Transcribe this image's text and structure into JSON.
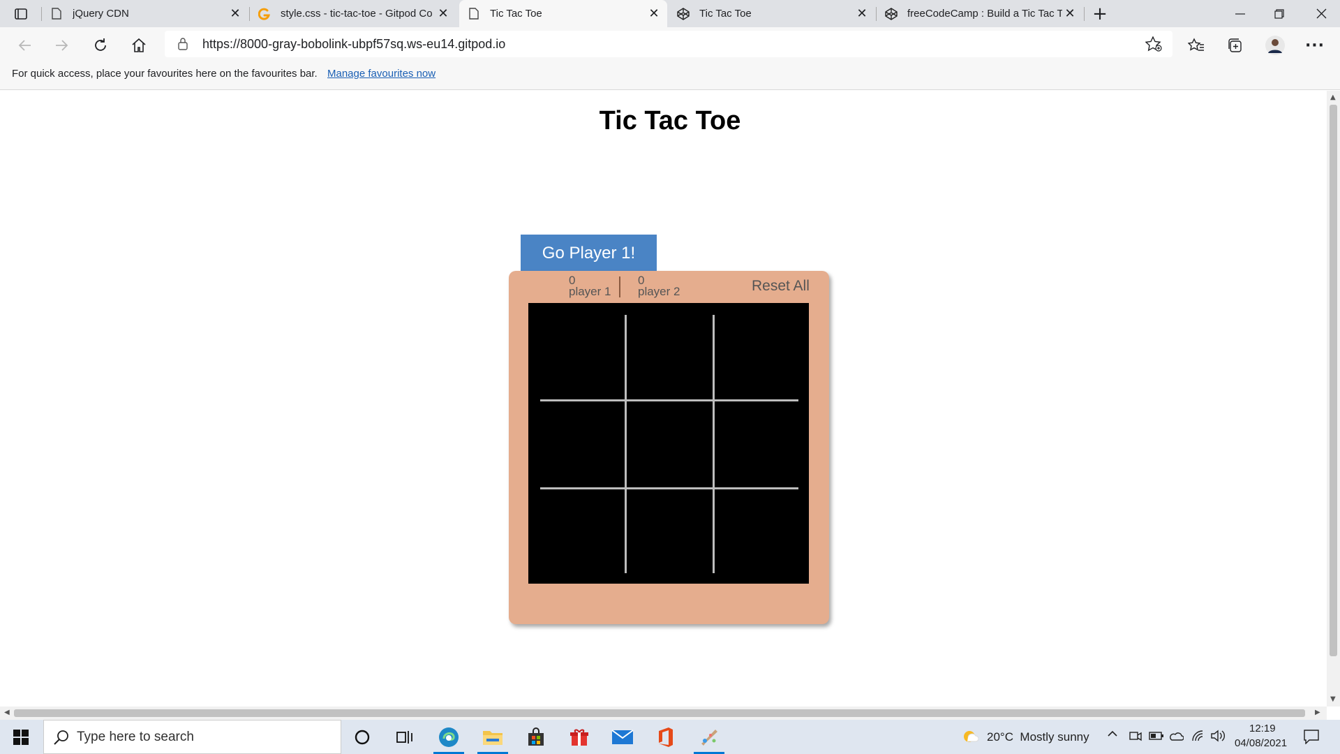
{
  "tabs": [
    {
      "title": "jQuery CDN",
      "icon": "page-icon"
    },
    {
      "title": "style.css - tic-tac-toe - Gitpod Co",
      "icon": "gitpod-icon"
    },
    {
      "title": "Tic Tac Toe",
      "icon": "page-icon",
      "active": true
    },
    {
      "title": "Tic Tac Toe",
      "icon": "codepen-icon"
    },
    {
      "title": "freeCodeCamp : Build a Tic Tac To",
      "icon": "codepen-icon"
    }
  ],
  "address_bar": {
    "url": "https://8000-gray-bobolink-ubpf57sq.ws-eu14.gitpod.io"
  },
  "favourites_bar": {
    "message": "For quick access, place your favourites here on the favourites bar.",
    "link": "Manage favourites now"
  },
  "game": {
    "title": "Tic Tac Toe",
    "turn_button": "Go Player 1!",
    "player1": {
      "score": "0",
      "label": "player 1"
    },
    "player2": {
      "score": "0",
      "label": "player 2"
    },
    "reset_label": "Reset All",
    "colors": {
      "panel": "#e5ad8e",
      "board": "#000000",
      "button": "#4a84c5",
      "grid": "#bdbdbd"
    }
  },
  "taskbar": {
    "search_placeholder": "Type here to search",
    "weather": "20°C  Mostly sunny",
    "time": "12:19",
    "date": "04/08/2021",
    "pinned": [
      "cortana-icon",
      "task-view-icon",
      "edge-icon",
      "file-explorer-icon",
      "store-icon",
      "gift-icon",
      "mail-icon",
      "office-icon",
      "paint-icon"
    ]
  }
}
